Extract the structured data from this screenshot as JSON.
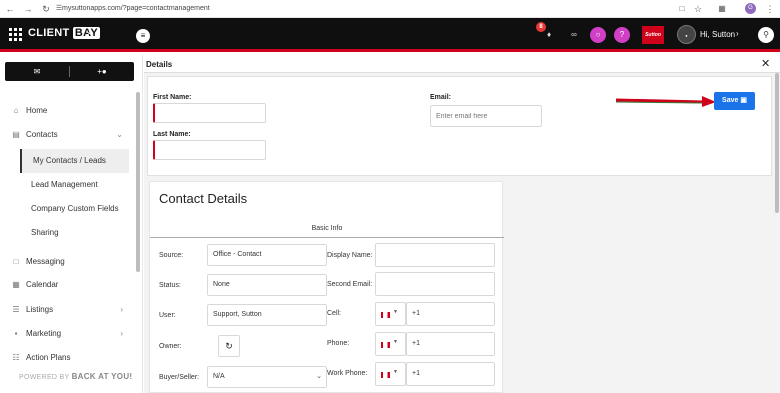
{
  "browser": {
    "url": "mysuttonapps.com/?page=contactmanagement",
    "profile_initial": "G"
  },
  "topbar": {
    "logo_client": "CLIENT",
    "logo_bay": "BAY",
    "notification_count": "8",
    "brand_badge": "Sutton",
    "user_greeting": "Hi, Sutton"
  },
  "sidebar": {
    "items": [
      {
        "label": "Home",
        "icon": "home-icon"
      },
      {
        "label": "Contacts",
        "icon": "contacts-icon"
      },
      {
        "label": "Messaging",
        "icon": "message-icon"
      },
      {
        "label": "Calendar",
        "icon": "calendar-icon"
      },
      {
        "label": "Listings",
        "icon": "listings-icon"
      },
      {
        "label": "Marketing",
        "icon": "marketing-icon"
      },
      {
        "label": "Action Plans",
        "icon": "action-plans-icon"
      }
    ],
    "subitems": [
      {
        "label": "My Contacts / Leads"
      },
      {
        "label": "Lead Management"
      },
      {
        "label": "Company Custom Fields"
      },
      {
        "label": "Sharing"
      }
    ],
    "powered_by": "POWERED BY",
    "powered_brand": "BACK AT YOU!"
  },
  "details": {
    "title": "Details",
    "first_name_label": "First Name:",
    "last_name_label": "Last Name:",
    "email_label": "Email:",
    "email_placeholder": "Enter email here",
    "save_label": "Save"
  },
  "contact_details": {
    "title": "Contact Details",
    "section": "Basic Info",
    "source_label": "Source:",
    "source_value": "Office - Contact",
    "status_label": "Status:",
    "status_value": "None",
    "user_label": "User:",
    "user_value": "Support, Sutton",
    "owner_label": "Owner:",
    "buyer_seller_label": "Buyer/Seller:",
    "buyer_seller_value": "N/A",
    "display_name_label": "Display Name:",
    "second_email_label": "Second Email:",
    "cell_label": "Cell:",
    "cell_value": "+1",
    "phone_label": "Phone:",
    "phone_value": "+1",
    "work_phone_label": "Work Phone:",
    "work_phone_value": "+1"
  },
  "colors": {
    "accent_red": "#d0021b",
    "save_blue": "#1a73e8",
    "annotation_arrow": "#d0021b"
  }
}
